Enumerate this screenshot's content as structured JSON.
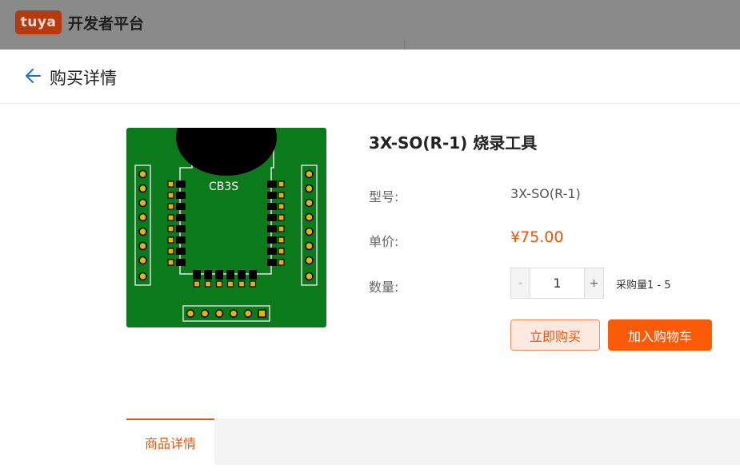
{
  "topbar": {
    "logo_text": "tuya",
    "platform_name": "开发者平台"
  },
  "header": {
    "title": "购买详情",
    "back_icon": "arrow-left-icon",
    "accent_color": "#1a6fd6"
  },
  "product": {
    "name": "3X-SO(R-1) 烧录工具",
    "image_label": "CB3S",
    "model_label": "型号:",
    "model_value": "3X-SO(R-1)",
    "price_label": "单价:",
    "price_value": "¥75.00",
    "quantity_label": "数量:",
    "quantity_value": "1",
    "quantity_minus": "-",
    "quantity_plus": "+",
    "quantity_range": "采购量1 - 5"
  },
  "actions": {
    "buy_now": "立即购买",
    "add_to_cart": "加入购物车",
    "primary_color": "#fa5b09"
  },
  "tabs": {
    "items": [
      {
        "label": "商品详情",
        "active": true
      }
    ]
  }
}
